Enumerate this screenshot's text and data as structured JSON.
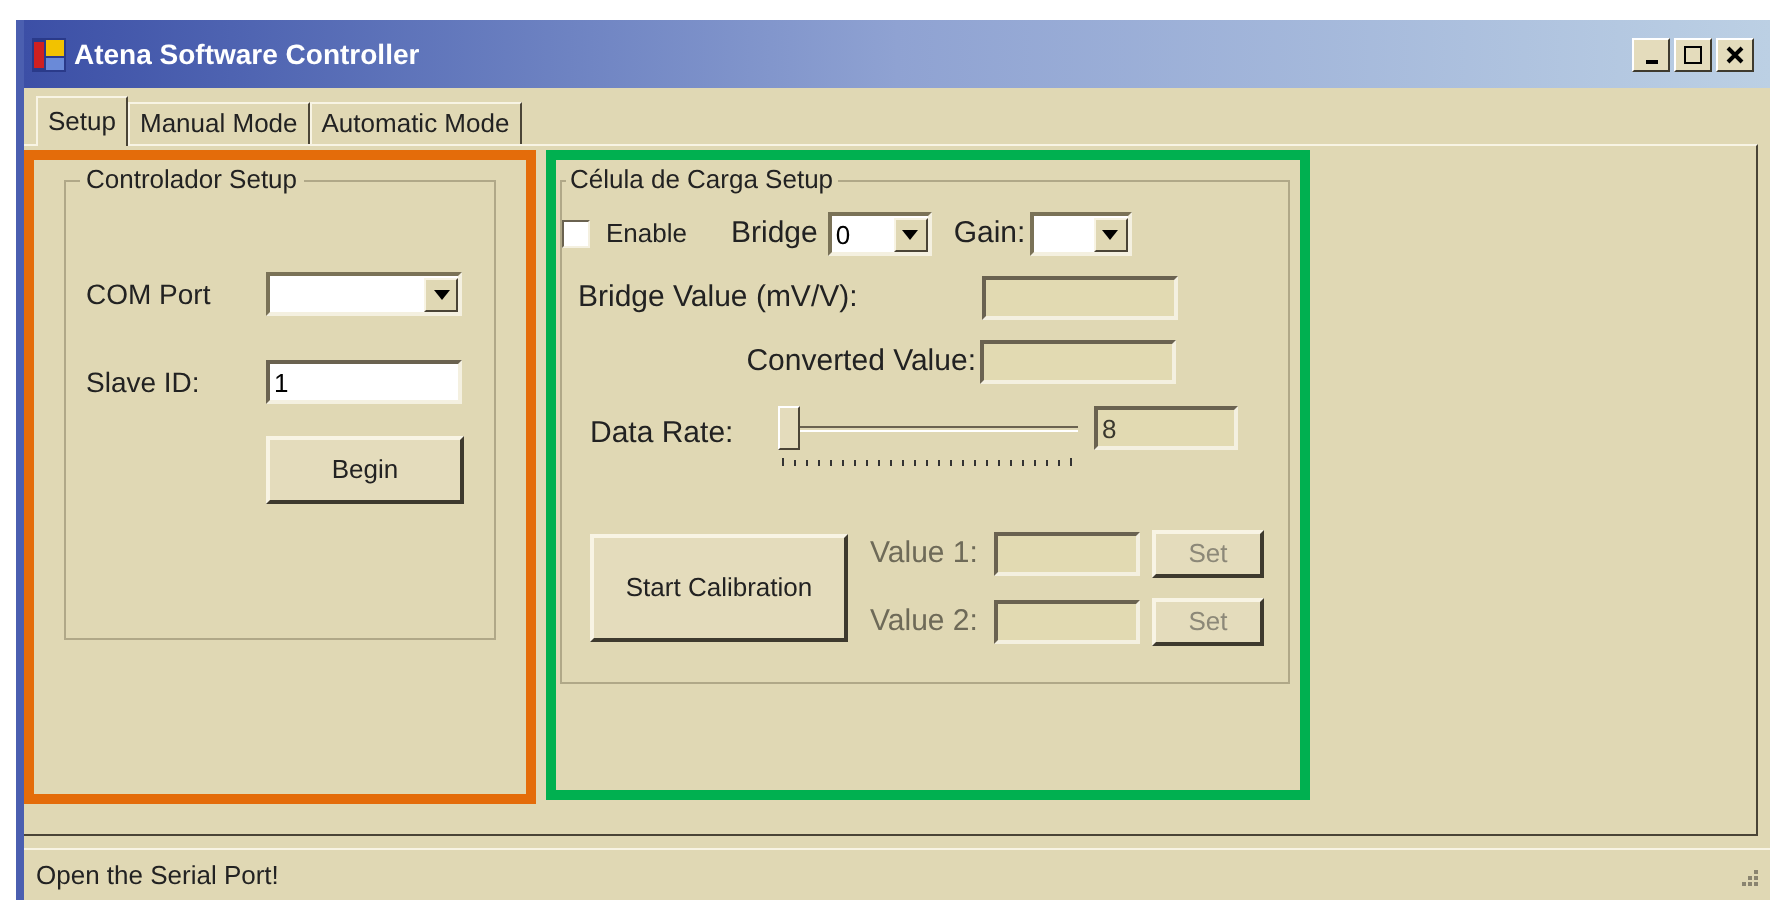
{
  "window": {
    "title": "Atena Software Controller"
  },
  "tabs": [
    {
      "label": "Setup",
      "selected": true
    },
    {
      "label": "Manual Mode",
      "selected": false
    },
    {
      "label": "Automatic Mode",
      "selected": false
    }
  ],
  "annotations": [
    {
      "color": "#e46c0a"
    },
    {
      "color": "#00b050"
    }
  ],
  "controller_panel": {
    "group_title": "Controlador Setup",
    "com_port": {
      "label": "COM Port"
    },
    "slave_id": {
      "label": "Slave ID:",
      "value": "1"
    },
    "begin_button": "Begin"
  },
  "load_cell_panel": {
    "group_title": "Célula de Carga Setup",
    "enable": {
      "label": "Enable",
      "checked": false
    },
    "bridge": {
      "label": "Bridge",
      "value": "0"
    },
    "gain": {
      "label": "Gain:"
    },
    "bridge_value": {
      "label": "Bridge Value (mV/V):"
    },
    "converted_value": {
      "label": "Converted Value:"
    },
    "data_rate": {
      "label": "Data Rate:",
      "level": 0,
      "value": "8"
    },
    "calibration_button": "Start Calibration",
    "values": [
      {
        "label": "Value 1:",
        "button": "Set",
        "disabled": true
      },
      {
        "label": "Value 2:",
        "button": "Set",
        "disabled": true
      }
    ]
  },
  "status_bar": {
    "text": "Open the Serial Port!"
  }
}
